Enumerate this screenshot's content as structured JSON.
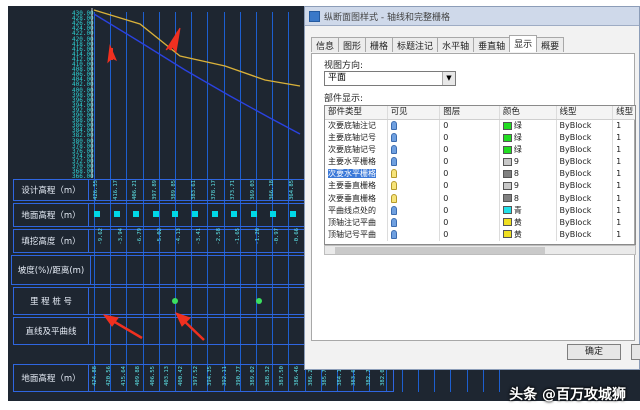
{
  "cad": {
    "ruler": [
      "430.00",
      "428.00",
      "426.00",
      "424.00",
      "422.00",
      "420.00",
      "418.00",
      "416.00",
      "414.00",
      "412.00",
      "410.00",
      "408.00",
      "406.00",
      "404.00",
      "402.00",
      "400.00",
      "398.00",
      "396.00",
      "394.00",
      "392.00",
      "390.00",
      "388.00",
      "386.00",
      "384.00",
      "382.00",
      "380.00",
      "378.00",
      "376.00",
      "374.00",
      "372.00",
      "370.00",
      "368.00",
      "366.00"
    ],
    "labels": {
      "design_elev": "设计高程（m）",
      "ground_elev": "地面高程（m）",
      "cut_fill": "填挖高度（m）",
      "slope": "坡度(%)/距离(m)",
      "station": "里 程 桩 号",
      "curve": "直线及平曲线",
      "ground_elev2": "地面高程（m）"
    },
    "design_values": [
      "426.55",
      "416.17",
      "406.21",
      "397.89",
      "389.85",
      "383.61",
      "378.17",
      "373.71",
      "369.03",
      "366.18",
      "364.85"
    ],
    "ground_values": [
      "-9.62",
      "-3.94",
      "-6.79",
      "-5.02",
      "-4.13",
      "-3.41",
      "-2.58",
      "-1.65",
      "-1.28",
      "-0.97",
      "-0.66"
    ],
    "bottom_values": [
      "424.88",
      "420.56",
      "415.64",
      "409.88",
      "406.55",
      "403.13",
      "400.42",
      "397.52",
      "394.35",
      "392.11",
      "390.77",
      "389.02",
      "388.32",
      "387.50",
      "386.46",
      "386.21",
      "385.75",
      "384.16",
      "383.61",
      "382.74",
      "382.09"
    ],
    "watermark": "头条 @百万攻城狮"
  },
  "dialog": {
    "title": "纵断面图样式 - 轴线和完整栅格",
    "tabs": [
      "信息",
      "图形",
      "栅格",
      "标题注记",
      "水平轴",
      "垂直轴",
      "显示",
      "概要"
    ],
    "active_tab": "显示",
    "view_dir_label": "视图方向:",
    "view_dir_value": "平面",
    "comp_display_label": "部件显示:",
    "columns": [
      "部件类型",
      "可见",
      "图层",
      "颜色",
      "线型",
      "线型"
    ],
    "rows": [
      {
        "type": "次要底轴注记",
        "layer": "0",
        "color": "绿",
        "hex": "#22dd22",
        "ltype": "ByBlock",
        "w": "1",
        "bulb": "blue"
      },
      {
        "type": "主要底轴记号",
        "layer": "0",
        "color": "绿",
        "hex": "#22dd22",
        "ltype": "ByBlock",
        "w": "1",
        "bulb": "blue"
      },
      {
        "type": "次要底轴记号",
        "layer": "0",
        "color": "绿",
        "hex": "#22dd22",
        "ltype": "ByBlock",
        "w": "1",
        "bulb": "blue"
      },
      {
        "type": "主要水平栅格",
        "layer": "0",
        "color": "9",
        "hex": "#c8c8c8",
        "ltype": "ByBlock",
        "w": "1",
        "bulb": "blue"
      },
      {
        "type": "次要水平栅格",
        "layer": "0",
        "color": "8",
        "hex": "#808080",
        "ltype": "ByBlock",
        "w": "1",
        "bulb": "yellow"
      },
      {
        "type": "主要垂直栅格",
        "layer": "0",
        "color": "9",
        "hex": "#c8c8c8",
        "ltype": "ByBlock",
        "w": "1",
        "bulb": "yellow"
      },
      {
        "type": "次要垂直栅格",
        "layer": "0",
        "color": "8",
        "hex": "#808080",
        "ltype": "ByBlock",
        "w": "1",
        "bulb": "yellow"
      },
      {
        "type": "平曲线点处的",
        "layer": "0",
        "color": "青",
        "hex": "#22e0e8",
        "ltype": "ByBlock",
        "w": "1",
        "bulb": "blue"
      },
      {
        "type": "顶轴注记平曲",
        "layer": "0",
        "color": "黄",
        "hex": "#f0e020",
        "ltype": "ByBlock",
        "w": "1",
        "bulb": "blue"
      },
      {
        "type": "顶轴记号平曲",
        "layer": "0",
        "color": "黄",
        "hex": "#f0e020",
        "ltype": "ByBlock",
        "w": "1",
        "bulb": "blue"
      }
    ],
    "selected_row": 4,
    "ok_label": "确定"
  }
}
